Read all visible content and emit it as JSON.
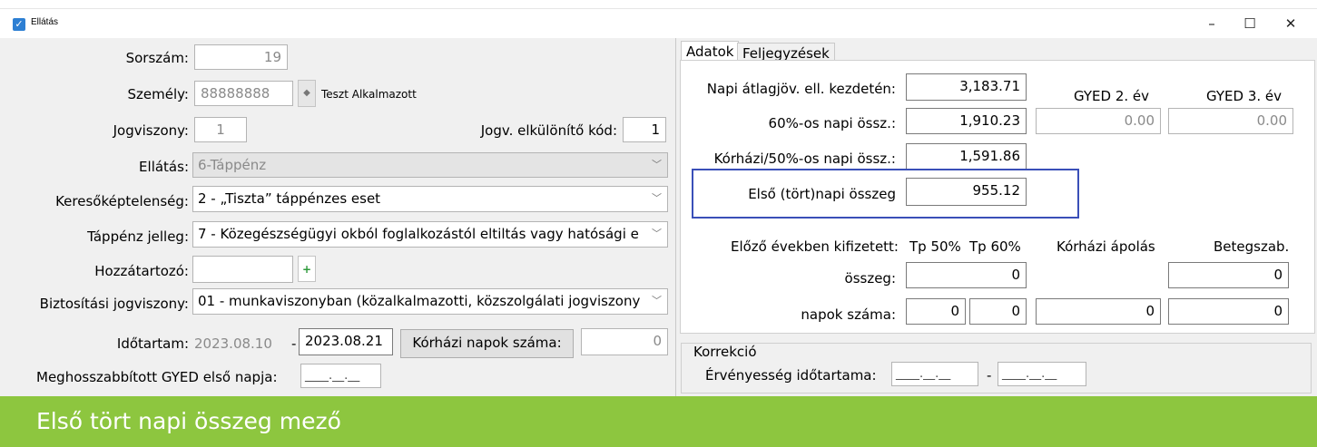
{
  "window": {
    "title": "Ellátás",
    "minimize": "–",
    "maximize": "☐",
    "close": "✕"
  },
  "left": {
    "sorszam": {
      "label": "Sorszám:",
      "value": "19"
    },
    "szemely": {
      "label": "Személy:",
      "value": "88888888",
      "name": "Teszt Alkalmazott"
    },
    "jogviszony": {
      "label": "Jogviszony:",
      "value": "1"
    },
    "jogv_kod": {
      "label": "Jogv. elkülönítő kód:",
      "value": "1"
    },
    "ellatas": {
      "label": "Ellátás:",
      "value": "6-Táppénz"
    },
    "keresokeptelenseg": {
      "label": "Keresőképtelenség:",
      "value": "2 - „Tiszta” táppénzes eset"
    },
    "tappenz_jelleg": {
      "label": "Táppénz jelleg:",
      "value": "7 - Közegészségügyi okból foglalkozástól eltiltás vagy hatósági e"
    },
    "hozzatartozo": {
      "label": "Hozzátartozó:",
      "value": ""
    },
    "biztositasi": {
      "label": "Biztosítási jogviszony:",
      "value": "01 - munkaviszonyban (közalkalmazotti, közszolgálati jogviszony"
    },
    "idotartam": {
      "label": "Időtartam:",
      "from": "2023.08.10",
      "dash": "-",
      "to": "2023.08.21"
    },
    "korhazi_napok": {
      "button": "Kórházi napok száma:",
      "value": "0"
    },
    "gyed": {
      "label": "Meghosszabbított GYED első napja:",
      "value": "____.__.__"
    }
  },
  "tabs": [
    "Adatok",
    "Feljegyzések"
  ],
  "right": {
    "napi_atlag": {
      "label": "Napi átlagjöv. ell. kezdetén:",
      "value": "3,183.71"
    },
    "gyed2": {
      "label": "GYED 2. év",
      "value": "0.00"
    },
    "gyed3": {
      "label": "GYED 3. év",
      "value": "0.00"
    },
    "napi60": {
      "label": "60%-os napi össz.:",
      "value": "1,910.23"
    },
    "korhazi50": {
      "label": "Kórházi/50%-os napi össz.:",
      "value": "1,591.86"
    },
    "elso_tort": {
      "label": "Első (tört)napi összeg",
      "value": "955.12"
    },
    "elozo": {
      "label": "Előző években kifizetett:",
      "col_tp50": "Tp 50%",
      "col_tp60": "Tp 60%",
      "col_korhazi": "Kórházi ápolás",
      "col_beteg": "Betegszab.",
      "osszeg_label": "összeg:",
      "osszeg_tp": "0",
      "osszeg_beteg": "0",
      "napok_label": "napok száma:",
      "napok_tp50": "0",
      "napok_tp60": "0",
      "napok_korhazi": "0",
      "napok_beteg": "0"
    },
    "korrekcio": {
      "title": "Korrekció",
      "label": "Érvényesség időtartama:",
      "from": "____.__.__",
      "dash": "-",
      "to": "____.__.__"
    }
  },
  "footer": {
    "caption": "Első tört napi összeg mező"
  },
  "colors": {
    "footer": "#8dc63f",
    "highlight": "#3a4fb8"
  }
}
